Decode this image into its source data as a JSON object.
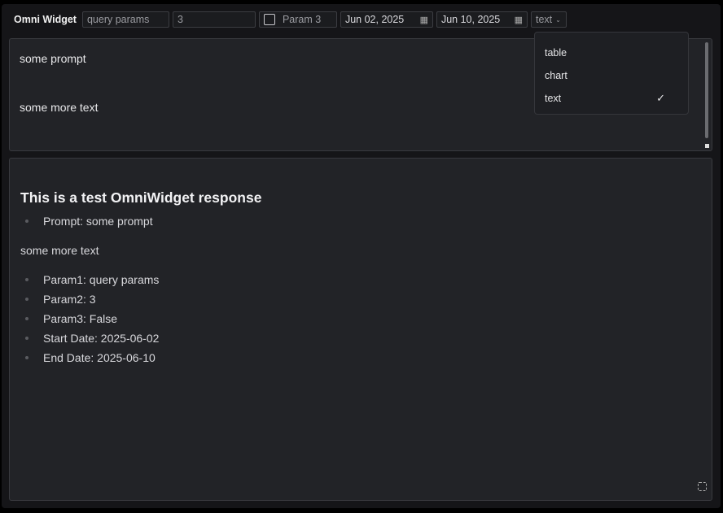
{
  "toolbar": {
    "title": "Omni Widget",
    "param1": "query params",
    "param2": "3",
    "param3_label": "Param 3",
    "start_date": "Jun 02, 2025",
    "end_date": "Jun 10, 2025",
    "format": "text"
  },
  "format_menu": {
    "options": [
      {
        "label": "table"
      },
      {
        "label": "chart"
      },
      {
        "label": "text",
        "selected": true
      }
    ],
    "check": "✓"
  },
  "prompt": {
    "line1": "some prompt",
    "line2": "some more text"
  },
  "response": {
    "heading": "This is a test OmniWidget response",
    "prompt_item": "Prompt: some prompt",
    "paragraph": "some more text",
    "items": [
      "Param1: query params",
      "Param2: 3",
      "Param3: False",
      "Start Date: 2025-06-02",
      "End Date: 2025-06-10"
    ]
  }
}
